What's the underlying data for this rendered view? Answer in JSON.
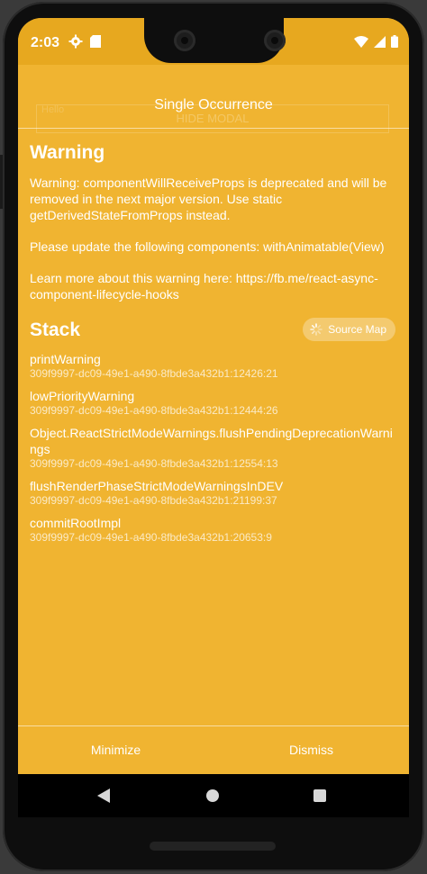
{
  "status_bar": {
    "time": "2:03",
    "icons": [
      "gear-icon",
      "sd-card-icon",
      "wifi-icon",
      "signal-icon",
      "battery-icon"
    ]
  },
  "background": {
    "hidden_text": "Hello",
    "hidden_button": "HIDE MODAL"
  },
  "header": {
    "title": "Single Occurrence"
  },
  "warning": {
    "heading": "Warning",
    "paragraphs": [
      "Warning: componentWillReceiveProps is deprecated and will be removed in the next major version. Use static getDerivedStateFromProps instead.",
      "Please update the following components: withAnimatable(View)",
      "Learn more about this warning here: https://fb.me/react-async-component-lifecycle-hooks"
    ]
  },
  "stack": {
    "heading": "Stack",
    "source_map_label": "Source Map",
    "frames": [
      {
        "name": "printWarning",
        "location": "309f9997-dc09-49e1-a490-8fbde3a432b1:12426:21"
      },
      {
        "name": "lowPriorityWarning",
        "location": "309f9997-dc09-49e1-a490-8fbde3a432b1:12444:26"
      },
      {
        "name": "Object.ReactStrictModeWarnings.flushPendingDeprecationWarnings",
        "location": "309f9997-dc09-49e1-a490-8fbde3a432b1:12554:13"
      },
      {
        "name": "flushRenderPhaseStrictModeWarningsInDEV",
        "location": "309f9997-dc09-49e1-a490-8fbde3a432b1:21199:37"
      },
      {
        "name": "commitRootImpl",
        "location": "309f9997-dc09-49e1-a490-8fbde3a432b1:20653:9"
      }
    ]
  },
  "footer": {
    "minimize_label": "Minimize",
    "dismiss_label": "Dismiss"
  },
  "colors": {
    "overlay": "#f0b431",
    "status_bar": "#e7a81f",
    "text": "#ffffff"
  }
}
